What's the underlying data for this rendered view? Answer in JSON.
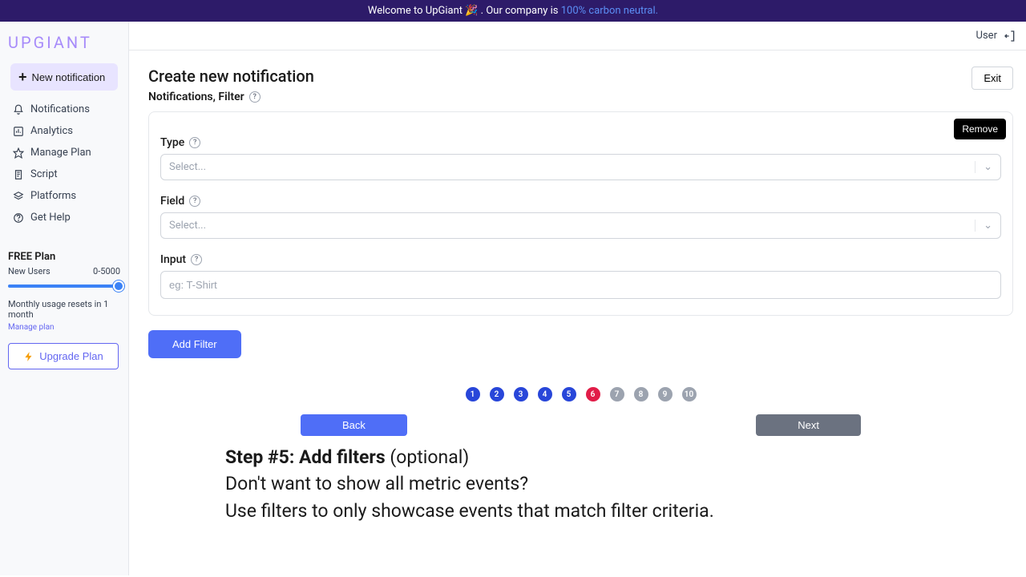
{
  "banner": {
    "text_a": "Welcome to UpGiant 🎉 . Our company is ",
    "link": "100% carbon neutral."
  },
  "brand": "UPGIANT",
  "sidebar": {
    "new_notif": "New notification",
    "items": [
      {
        "label": "Notifications"
      },
      {
        "label": "Analytics"
      },
      {
        "label": "Manage Plan"
      },
      {
        "label": "Script"
      },
      {
        "label": "Platforms"
      },
      {
        "label": "Get Help"
      }
    ],
    "plan": {
      "name": "FREE Plan",
      "metric": "New Users",
      "range": "0-5000",
      "note": "Monthly usage resets in 1 month",
      "manage": "Manage plan",
      "upgrade": "Upgrade Plan"
    }
  },
  "topbar": {
    "user": "User"
  },
  "page": {
    "title": "Create new notification",
    "subtitle": "Notifications, Filter",
    "exit": "Exit"
  },
  "filter": {
    "remove": "Remove",
    "type_label": "Type",
    "type_placeholder": "Select...",
    "field_label": "Field",
    "field_placeholder": "Select...",
    "input_label": "Input",
    "input_placeholder": "eg: T-Shirt",
    "add": "Add Filter"
  },
  "steps": [
    "1",
    "2",
    "3",
    "4",
    "5",
    "6",
    "7",
    "8",
    "9",
    "10"
  ],
  "current_step": 6,
  "nav": {
    "back": "Back",
    "next": "Next"
  },
  "instructions": {
    "bold": "Step #5: Add filters",
    "opt": " (optional)",
    "line2": "Don't want to show all metric events?",
    "line3": "Use filters to only showcase events that match filter criteria."
  }
}
